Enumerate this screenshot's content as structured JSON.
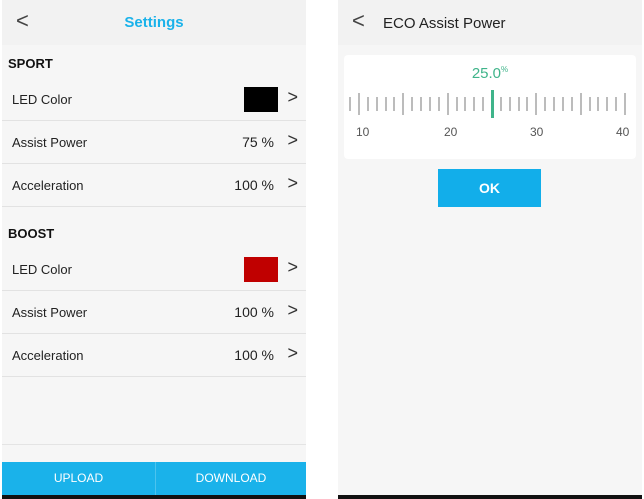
{
  "left_screen": {
    "back_glyph": "<",
    "title": "Settings",
    "sections": [
      {
        "name": "SPORT",
        "rows": [
          {
            "label": "LED Color",
            "swatch_color": "#000000"
          },
          {
            "label": "Assist Power",
            "value": "75 %"
          },
          {
            "label": "Acceleration",
            "value": "100 %"
          }
        ]
      },
      {
        "name": "BOOST",
        "rows": [
          {
            "label": "LED Color",
            "swatch_color": "#c00000"
          },
          {
            "label": "Assist Power",
            "value": "100 %"
          },
          {
            "label": "Acceleration",
            "value": "100 %"
          }
        ]
      }
    ],
    "upload_label": "UPLOAD",
    "download_label": "DOWNLOAD",
    "accent_color": "#1ab2ea"
  },
  "right_screen": {
    "back_glyph": "<",
    "title": "ECO Assist Power",
    "ruler": {
      "value": "25.0",
      "unit": "%",
      "min": 10,
      "max": 40,
      "current": 25,
      "tick_labels": [
        "10",
        "20",
        "30",
        "40"
      ]
    },
    "ok_label": "OK",
    "pointer_color": "#3fb48a"
  }
}
